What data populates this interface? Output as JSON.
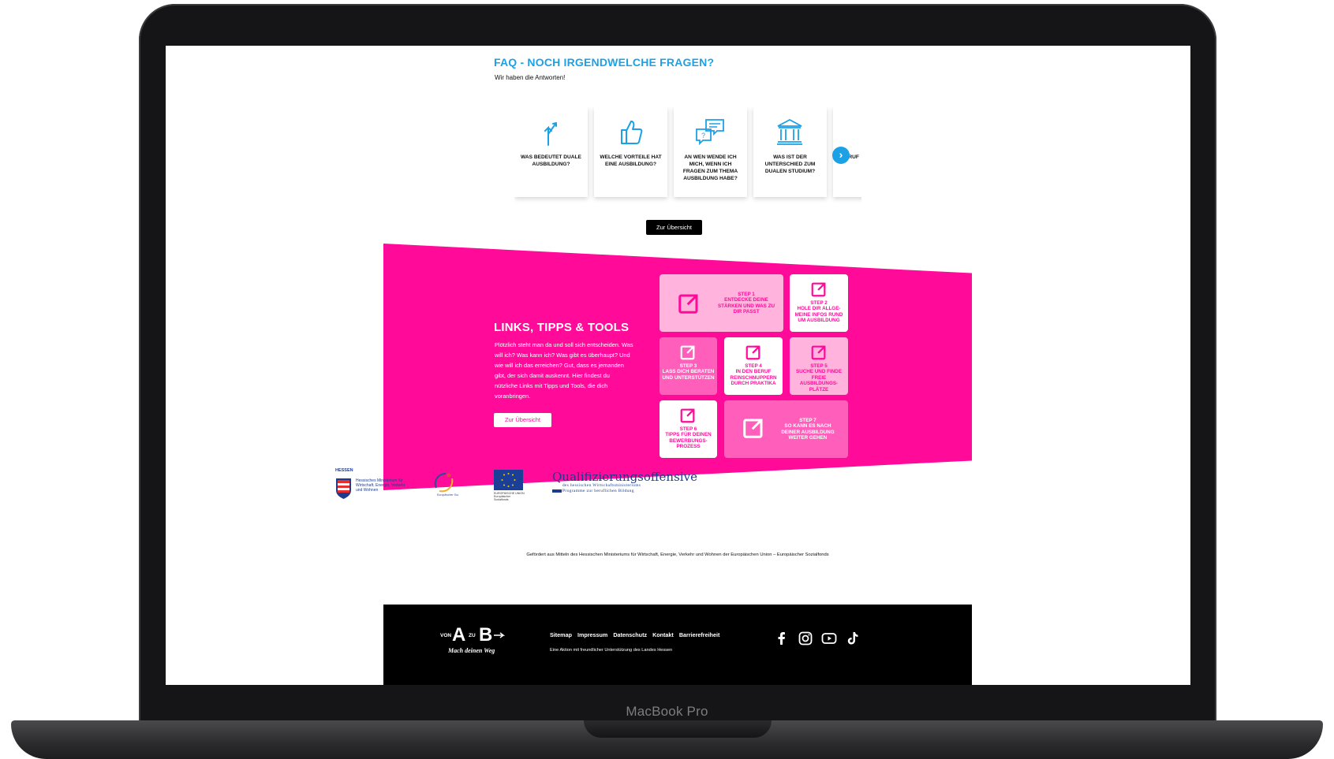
{
  "device": {
    "model_label": "MacBook Pro"
  },
  "faq": {
    "title": "FAQ - NOCH IRGENDWELCHE FRAGEN?",
    "subtitle": "Wir haben die Antworten!",
    "cards": [
      {
        "label": "WAS BEDEUTET DUALE AUSBILDUNG?",
        "icon": "split-arrow-icon"
      },
      {
        "label": "WELCHE VORTEILE HAT EINE AUSBILDUNG?",
        "icon": "thumbs-up-icon"
      },
      {
        "label": "AN WEN WENDE ICH MICH, WENN ICH FRAGEN ZUM THEMA AUSBILDUNG HABE?",
        "icon": "chat-bubbles-icon"
      },
      {
        "label": "WAS IST DER UNTERSCHIED ZUM DUALEN STUDIUM?",
        "icon": "institution-icon"
      },
      {
        "label": "E BERUF",
        "icon": ""
      }
    ],
    "next_icon": "chevron-right-icon",
    "overview_button": "Zur Übersicht",
    "accent_color": "#1da1e6"
  },
  "links": {
    "title": "LINKS, TIPPS & TOOLS",
    "text": "Plötzlich steht man da und soll sich entscheiden. Was will ich? Was kann ich? Was gibt es überhaupt? Und wie will ich das erreichen? Gut, dass es jemanden gibt, der sich damit auskennt. Hier findest du nützliche Links mit Tipps und Tools, die dich voranbringen.",
    "overview_button": "Zur Übersicht",
    "accent_color": "#ff0a99",
    "steps": [
      {
        "step": "STEP 1",
        "text": "ENTDECKE DEINE STÄRKEN UND WAS ZU DIR PASST"
      },
      {
        "step": "STEP 2",
        "text": "HOLE DIR ALLGE-MEINE INFOS RUND UM AUSBILDUNG"
      },
      {
        "step": "STEP 3",
        "text": "LASS DICH BERATEN UND UNTERSTÜTZEN"
      },
      {
        "step": "STEP 4",
        "text": "IN DEN BERUF REINSCHNUPPERN DURCH PRAKTIKA"
      },
      {
        "step": "STEP 5",
        "text": "SUCHE UND FINDE FREIE AUSBILDUNGS-PLÄTZE"
      },
      {
        "step": "STEP 6",
        "text": "TIPPS FÜR DEINEN BEWERBUNGS-PROZESS"
      },
      {
        "step": "STEP 7",
        "text": "SO KANN ES NACH DEINER AUSBILDUNG WEITER GEHEN"
      }
    ],
    "tile_icon": "external-link-icon"
  },
  "sponsors": {
    "hessen_label": "HESSEN",
    "hessen_text": "Hessisches Ministerium für Wirtschaft, Energie, Verkehr und Wohnen",
    "eu_caption": "EUROPÄISCHE UNION Europäischer Sozialfonds",
    "qo_title": "Qualifizierungsoffensive",
    "qo_sub1": "des hessischen Wirtschaftsministeriums",
    "qo_sub2": "Programme zur beruflichen Bildung",
    "funding_text": "Gefördert aus Mitteln des Hessischen Ministeriums für Wirtschaft, Energie, Verkehr und Wohnen der Europäischen Union – Europäischer Sozialfonds"
  },
  "footer": {
    "logo_text": {
      "von": "VON",
      "a": "A",
      "zu": "ZU",
      "b": "B",
      "tagline": "Mach deinen Weg"
    },
    "links": [
      "Sitemap",
      "Impressum",
      "Datenschutz",
      "Kontakt",
      "Barrierefreiheit"
    ],
    "note": "Eine Aktion mit freundlicher Unterstützung des Landes Hessen",
    "socials": [
      "facebook-icon",
      "instagram-icon",
      "youtube-icon",
      "tiktok-icon"
    ]
  }
}
